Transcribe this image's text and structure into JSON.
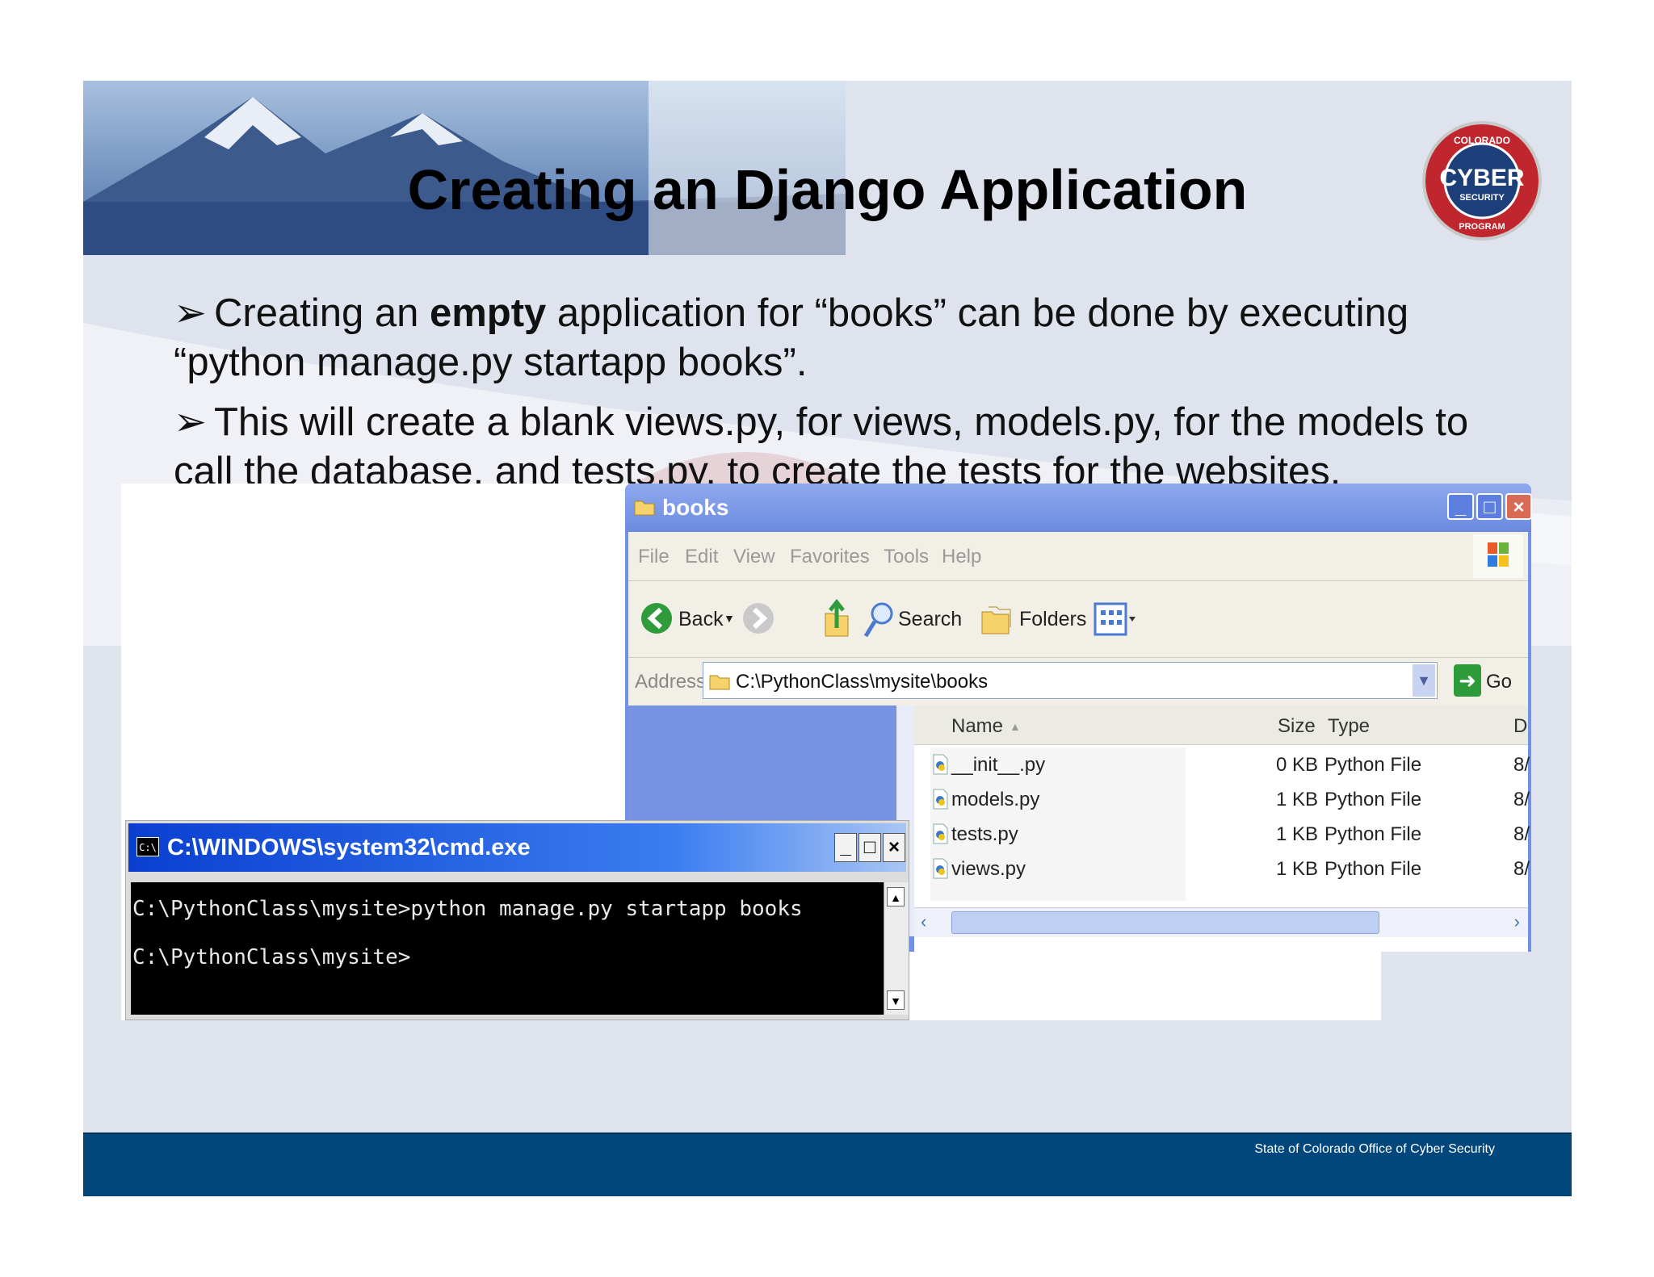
{
  "slide": {
    "title": "Creating an Django Application",
    "bullets": [
      {
        "arrow": "➢",
        "pre": "Creating an ",
        "bold": "empty",
        "post": " application for “books” can be done by executing “python manage.py startapp books”."
      },
      {
        "arrow": "➢",
        "text": "This will create a blank views.py, for views, models.py, for the models to call the database, and tests.py, to create the tests for the websites."
      }
    ],
    "footer": "State of Colorado Office of Cyber Security",
    "seal": {
      "top_text": "COLORADO",
      "main": "CYBER",
      "sub": "SECURITY",
      "bottom_text": "PROGRAM"
    }
  },
  "explorer": {
    "title": "books",
    "menu": [
      "File",
      "Edit",
      "View",
      "Favorites",
      "Tools",
      "Help"
    ],
    "toolbar": {
      "back": "Back",
      "search": "Search",
      "folders": "Folders"
    },
    "address_label": "Address",
    "address_value": "C:\\PythonClass\\mysite\\books",
    "go": "Go",
    "columns": {
      "name": "Name",
      "size": "Size",
      "type": "Type",
      "date": "D"
    },
    "files": [
      {
        "name": "__init__.py",
        "size": "0 KB",
        "type": "Python File",
        "date": "8/"
      },
      {
        "name": "models.py",
        "size": "1 KB",
        "type": "Python File",
        "date": "8/"
      },
      {
        "name": "tests.py",
        "size": "1 KB",
        "type": "Python File",
        "date": "8/"
      },
      {
        "name": "views.py",
        "size": "1 KB",
        "type": "Python File",
        "date": "8/"
      }
    ]
  },
  "cmd": {
    "title": "C:\\WINDOWS\\system32\\cmd.exe",
    "icon_text": "C:\\",
    "lines": [
      "C:\\PythonClass\\mysite>python manage.py startapp books",
      "C:\\PythonClass\\mysite>"
    ]
  },
  "colors": {
    "footer": "#02477c",
    "xp_title": "#7091e6",
    "cmd_title": "#0a3fd0"
  }
}
